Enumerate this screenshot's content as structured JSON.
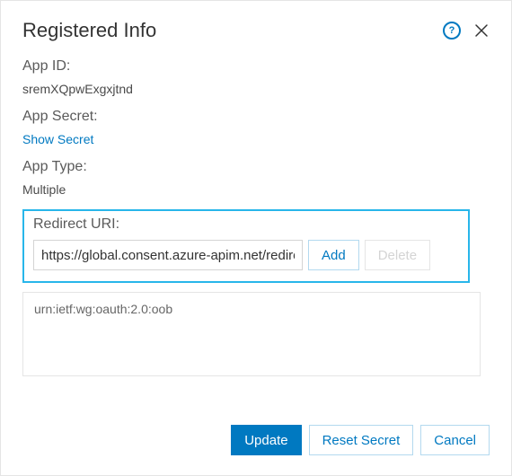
{
  "dialog": {
    "title": "Registered Info"
  },
  "icons": {
    "help": "?",
    "close": "✕"
  },
  "fields": {
    "app_id_label": "App ID:",
    "app_id_value": "sremXQpwExgxjtnd",
    "app_secret_label": "App Secret:",
    "show_secret": "Show Secret",
    "app_type_label": "App Type:",
    "app_type_value": "Multiple",
    "redirect_uri_label": "Redirect URI:",
    "redirect_uri_input": "https://global.consent.azure-apim.net/redirect"
  },
  "buttons": {
    "add": "Add",
    "delete": "Delete",
    "update": "Update",
    "reset_secret": "Reset Secret",
    "cancel": "Cancel"
  },
  "redirect_uris": {
    "items": [
      "urn:ietf:wg:oauth:2.0:oob"
    ]
  }
}
